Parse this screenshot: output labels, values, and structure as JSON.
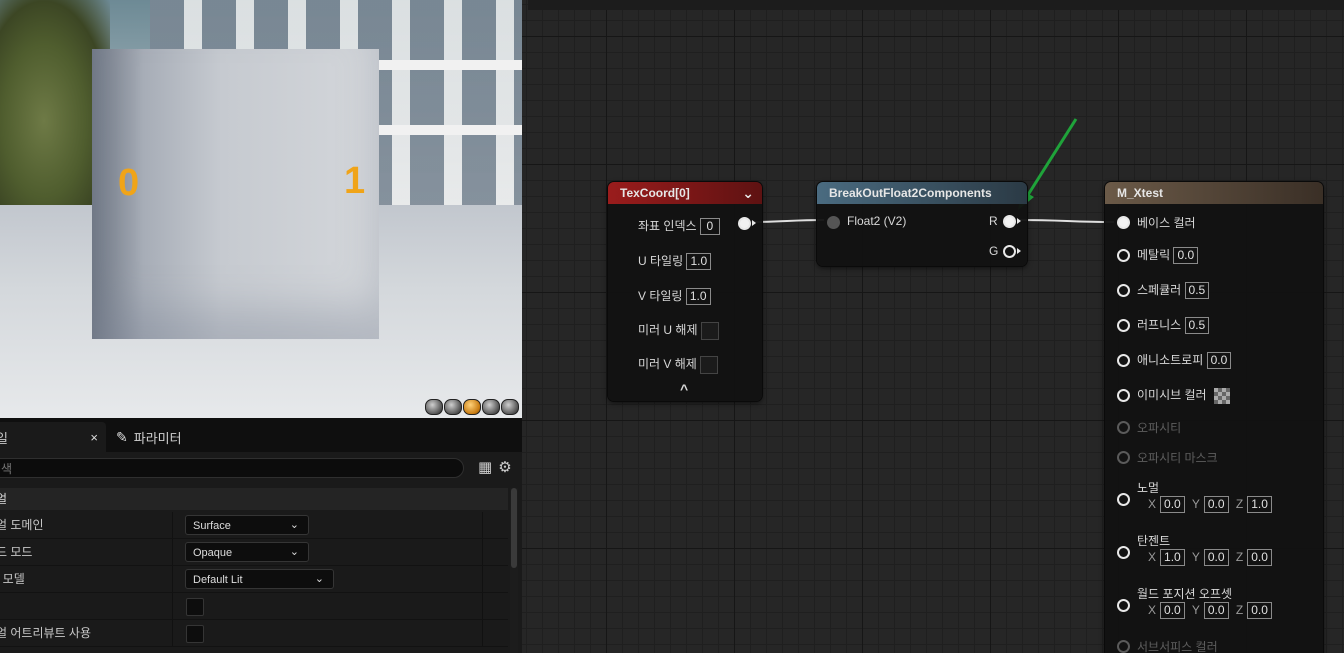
{
  "viewport": {
    "uv_left": "0",
    "uv_right": "1",
    "icons": [
      "sphere-icon",
      "sphere-icon",
      "cylinder-icon",
      "sphere-icon",
      "cube-icon"
    ]
  },
  "details": {
    "tab_details_label": "일",
    "tab_close": "×",
    "tab_params_label": "파라미터",
    "search_placeholder": "색",
    "section_label": "얼",
    "rows": [
      {
        "label": "얼 도메인",
        "value": "Surface"
      },
      {
        "label": "드 모드",
        "value": "Opaque"
      },
      {
        "label": "! 모델",
        "value": "Default Lit"
      },
      {
        "label": "",
        "value": ""
      },
      {
        "label": "얼 어트리뷰트 사용",
        "value": ""
      }
    ]
  },
  "graph": {
    "texcoord": {
      "title": "TexCoord[0]",
      "coord_index_label": "좌표 인덱스",
      "coord_index": "0",
      "u_tiling_label": "U 타일링",
      "u_tiling": "1.0",
      "v_tiling_label": "V 타일링",
      "v_tiling": "1.0",
      "mirror_u_label": "미러 U 해제",
      "mirror_v_label": "미러 V 해제",
      "collapse": "^"
    },
    "breakout": {
      "title": "BreakOutFloat2Components",
      "input_label": "Float2 (V2)",
      "out_r": "R",
      "out_g": "G"
    },
    "material": {
      "title": "M_Xtest",
      "base_color": "베이스 컬러",
      "metallic": "메탈릭",
      "metallic_val": "0.0",
      "specular": "스페큘러",
      "specular_val": "0.5",
      "roughness": "러프니스",
      "roughness_val": "0.5",
      "anisotropy": "애니소트로피",
      "anisotropy_val": "0.0",
      "emissive": "이미시브 컬러",
      "opacity": "오파시티",
      "opacity_mask": "오파시티 마스크",
      "normal": "노멀",
      "normal_x": "0.0",
      "normal_y": "0.0",
      "normal_z": "1.0",
      "tangent": "탄젠트",
      "tangent_x": "1.0",
      "tangent_y": "0.0",
      "tangent_z": "0.0",
      "wpo": "월드 포지션 오프셋",
      "wpo_x": "0.0",
      "wpo_y": "0.0",
      "wpo_z": "0.0",
      "subsurface": "서브서피스 컬러",
      "axis_x": "X",
      "axis_y": "Y",
      "axis_z": "Z"
    }
  },
  "colors": {
    "texcoord_header": "#8a1a1a",
    "breakout_header": "#3d5566",
    "material_header": "#5a4a3a",
    "annotation_arrow": "#1fa33a",
    "uv_label": "#f0a418"
  }
}
